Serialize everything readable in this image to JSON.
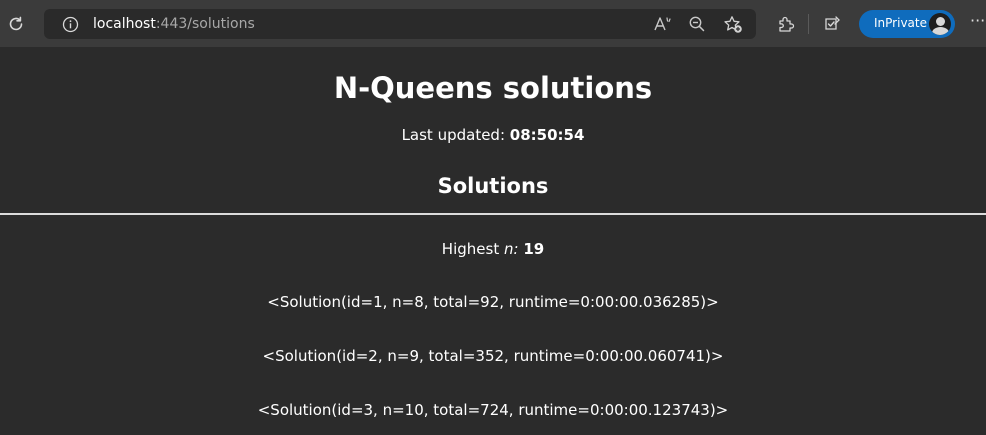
{
  "browser": {
    "url_host": "localhost",
    "url_path": ":443/solutions",
    "inprivate_label": "InPrivate",
    "more_label": "···",
    "icons": {
      "refresh": "refresh-icon",
      "info": "info-icon",
      "read_aloud": "read-aloud-icon",
      "zoom_out": "zoom-out-icon",
      "favorites_add": "favorites-add-icon",
      "extensions": "extensions-icon",
      "browser_essentials": "browser-essentials-icon",
      "profile": "profile-avatar-icon"
    },
    "colors": {
      "toolbar": "#3b3b3b",
      "addressbar": "#2a2a2a",
      "inprivate": "#0f6cbd",
      "page_background": "#2b2b2b"
    }
  },
  "page": {
    "title": "N-Queens solutions",
    "last_updated_label": "Last updated:",
    "last_updated_value": "08:50:54",
    "section_title": "Solutions",
    "highest_label": "Highest",
    "highest_var": "n:",
    "highest_value": "19",
    "solutions": [
      "<Solution(id=1, n=8, total=92, runtime=0:00:00.036285)>",
      "<Solution(id=2, n=9, total=352, runtime=0:00:00.060741)>",
      "<Solution(id=3, n=10, total=724, runtime=0:00:00.123743)>"
    ]
  }
}
